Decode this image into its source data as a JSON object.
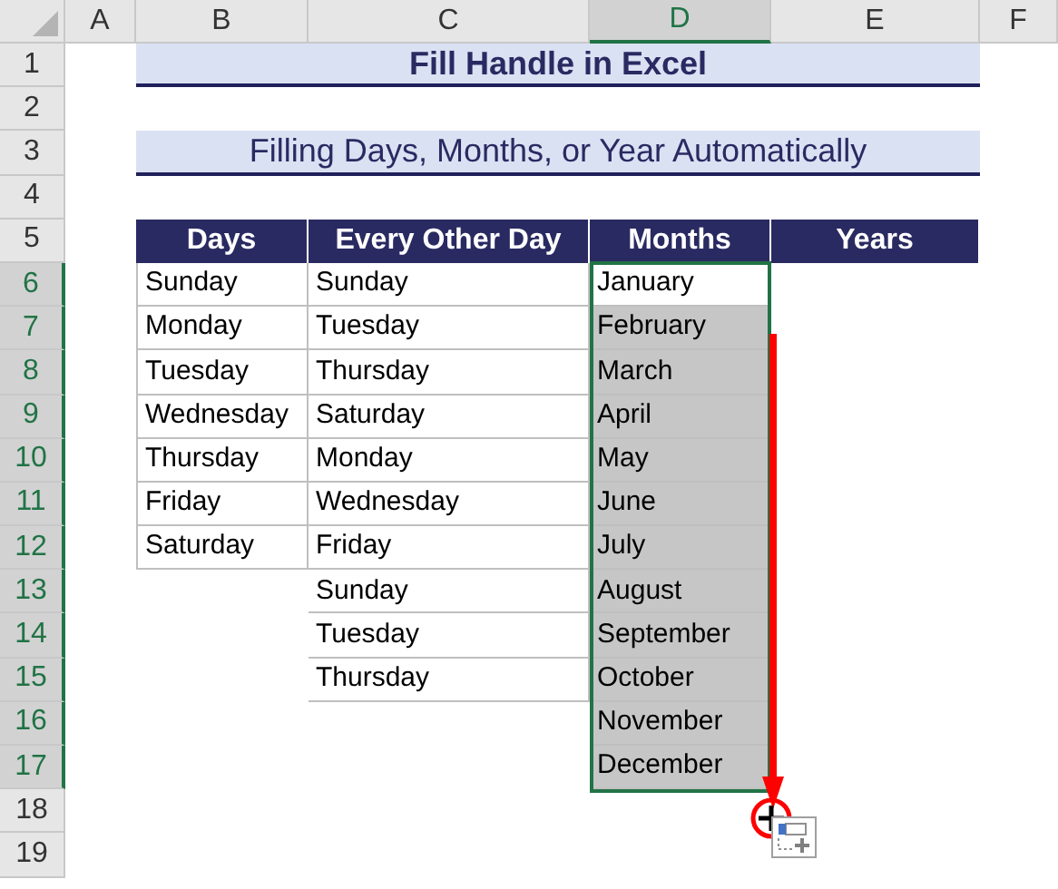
{
  "column_headers": [
    {
      "label": "A",
      "selected": false
    },
    {
      "label": "B",
      "selected": false
    },
    {
      "label": "C",
      "selected": false
    },
    {
      "label": "D",
      "selected": true
    },
    {
      "label": "E",
      "selected": false
    },
    {
      "label": "F",
      "selected": false
    }
  ],
  "row_headers": [
    {
      "label": "1",
      "selected": false
    },
    {
      "label": "2",
      "selected": false
    },
    {
      "label": "3",
      "selected": false
    },
    {
      "label": "4",
      "selected": false
    },
    {
      "label": "5",
      "selected": false
    },
    {
      "label": "6",
      "selected": true
    },
    {
      "label": "7",
      "selected": true
    },
    {
      "label": "8",
      "selected": true
    },
    {
      "label": "9",
      "selected": true
    },
    {
      "label": "10",
      "selected": true
    },
    {
      "label": "11",
      "selected": true
    },
    {
      "label": "12",
      "selected": true
    },
    {
      "label": "13",
      "selected": true
    },
    {
      "label": "14",
      "selected": true
    },
    {
      "label": "15",
      "selected": true
    },
    {
      "label": "16",
      "selected": true
    },
    {
      "label": "17",
      "selected": true
    },
    {
      "label": "18",
      "selected": false
    },
    {
      "label": "19",
      "selected": false
    }
  ],
  "title": "Fill Handle in Excel",
  "subtitle": "Filling Days, Months, or Year Automatically",
  "table": {
    "columns": [
      "Days",
      "Every Other Day",
      "Months",
      "Years"
    ],
    "rows": [
      {
        "days": "Sunday",
        "every_other_day": "Sunday",
        "month": {
          "text": "January",
          "selected": false
        }
      },
      {
        "days": "Monday",
        "every_other_day": "Tuesday",
        "month": {
          "text": "February",
          "selected": true
        }
      },
      {
        "days": "Tuesday",
        "every_other_day": "Thursday",
        "month": {
          "text": "March",
          "selected": true
        }
      },
      {
        "days": "Wednesday",
        "every_other_day": "Saturday",
        "month": {
          "text": "April",
          "selected": true
        }
      },
      {
        "days": "Thursday",
        "every_other_day": "Monday",
        "month": {
          "text": "May",
          "selected": true
        }
      },
      {
        "days": "Friday",
        "every_other_day": "Wednesday",
        "month": {
          "text": "June",
          "selected": true
        }
      },
      {
        "days": "Saturday",
        "every_other_day": "Friday",
        "month": {
          "text": "July",
          "selected": true
        }
      },
      {
        "every_other_day": "Sunday",
        "month": {
          "text": "August",
          "selected": true
        }
      },
      {
        "every_other_day": "Tuesday",
        "month": {
          "text": "September",
          "selected": true
        }
      },
      {
        "every_other_day": "Thursday",
        "month": {
          "text": "October",
          "selected": true
        }
      },
      {
        "month": {
          "text": "November",
          "selected": true
        }
      },
      {
        "month": {
          "text": "December",
          "selected": true
        }
      }
    ]
  }
}
